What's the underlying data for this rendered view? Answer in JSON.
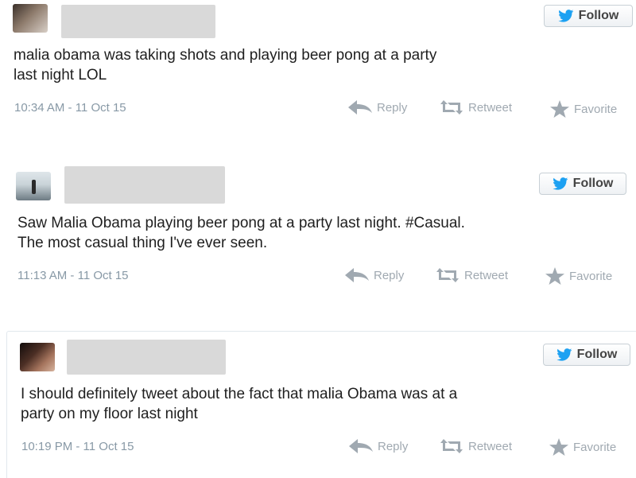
{
  "tweets": [
    {
      "text_lines": [
        "malia obama was taking shots and playing beer pong at a party",
        "last night LOL"
      ],
      "timestamp": "10:34 AM - 11 Oct 15",
      "follow_label": "Follow",
      "actions": {
        "reply": "Reply",
        "retweet": "Retweet",
        "favorite": "Favorite"
      }
    },
    {
      "text_lines": [
        "Saw Malia Obama playing beer pong at a party last night. #Casual.",
        "The most casual thing I've ever seen."
      ],
      "timestamp": "11:13 AM - 11 Oct 15",
      "follow_label": "Follow",
      "actions": {
        "reply": "Reply",
        "retweet": "Retweet",
        "favorite": "Favorite"
      }
    },
    {
      "text_lines": [
        "I should definitely tweet about the fact that malia Obama was at a",
        "party on my floor last night"
      ],
      "timestamp": "10:19 PM - 11 Oct 15",
      "follow_label": "Follow",
      "actions": {
        "reply": "Reply",
        "retweet": "Retweet",
        "favorite": "Favorite"
      }
    }
  ],
  "icons": {
    "follow": "twitter-bird-icon",
    "reply": "reply-arrow-icon",
    "retweet": "retweet-icon",
    "favorite": "star-icon"
  },
  "colors": {
    "twitter_blue": "#1da1f2",
    "meta_gray": "#8899a6",
    "action_gray": "#a0a9b1",
    "redaction_gray": "#d9d9d9"
  }
}
